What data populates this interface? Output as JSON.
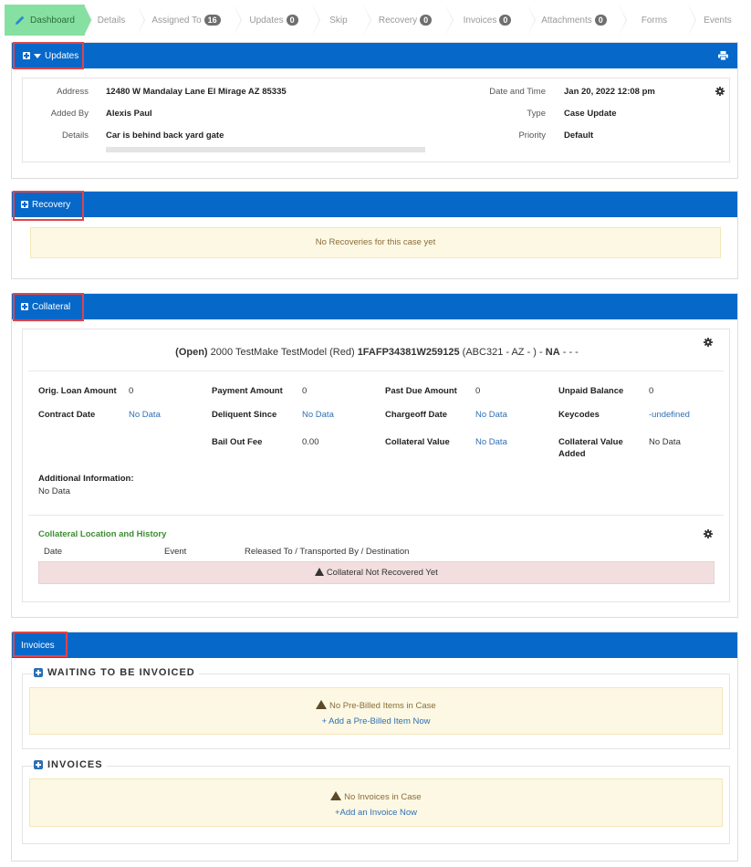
{
  "tabs": [
    {
      "label": "Dashboard",
      "active": true
    },
    {
      "label": "Details"
    },
    {
      "label": "Assigned To",
      "badge": "16"
    },
    {
      "label": "Updates",
      "badge": "0"
    },
    {
      "label": "Skip"
    },
    {
      "label": "Recovery",
      "badge": "0"
    },
    {
      "label": "Invoices",
      "badge": "0"
    },
    {
      "label": "Attachments",
      "badge": "0"
    },
    {
      "label": "Forms"
    },
    {
      "label": "Events"
    }
  ],
  "updates": {
    "title": "Updates",
    "address_label": "Address",
    "address": "12480 W Mandalay Lane El Mirage AZ 85335",
    "added_by_label": "Added By",
    "added_by": "Alexis Paul",
    "details_label": "Details",
    "details": "Car is behind back yard gate",
    "datetime_label": "Date and Time",
    "datetime": "Jan 20, 2022 12:08 pm",
    "type_label": "Type",
    "type": "Case Update",
    "priority_label": "Priority",
    "priority": "Default"
  },
  "recovery": {
    "title": "Recovery",
    "empty": "No Recoveries for this case yet"
  },
  "collateral": {
    "title": "Collateral",
    "summary_status": "(Open)",
    "summary_vehicle": "2000 TestMake TestModel (Red)",
    "summary_vin": "1FAFP34381W259125",
    "summary_plate": "(ABC321 - AZ - ) -",
    "summary_na": "NA",
    "summary_tail": "- - -",
    "fields": {
      "orig_loan_label": "Orig. Loan Amount",
      "orig_loan": "0",
      "payment_label": "Payment Amount",
      "payment": "0",
      "past_due_label": "Past Due Amount",
      "past_due": "0",
      "unpaid_label": "Unpaid Balance",
      "unpaid": "0",
      "contract_label": "Contract Date",
      "contract": "No Data",
      "delinquent_label": "Deliquent Since",
      "delinquent": "No Data",
      "chargeoff_label": "Chargeoff Date",
      "chargeoff": "No Data",
      "keycodes_label": "Keycodes",
      "keycodes": "-undefined",
      "bailout_label": "Bail Out Fee",
      "bailout": "0.00",
      "coll_value_label": "Collateral Value",
      "coll_value": "No Data",
      "coll_added_label_1": "Collateral Value",
      "coll_added_label_2": "Added",
      "coll_added": "No Data"
    },
    "additional_label": "Additional Information:",
    "additional": "No Data",
    "history_title": "Collateral Location and History",
    "history_cols": [
      "Date",
      "Event",
      "Released To / Transported By / Destination"
    ],
    "history_empty": "Collateral Not Recovered Yet"
  },
  "invoices": {
    "title": "Invoices",
    "waiting_title": "WAITING TO BE INVOICED",
    "waiting_empty": "No Pre-Billed Items in Case",
    "waiting_add": "+ Add a Pre-Billed Item Now",
    "invoices_title": "INVOICES",
    "invoices_empty": "No Invoices in Case",
    "invoices_add": "+Add an Invoice Now"
  },
  "colors": {
    "header_blue": "#0668c9",
    "active_tab": "#86e0a2",
    "highlight_red": "#e0434b",
    "notice_bg": "#fcf8e3",
    "error_bg": "#f2dede"
  }
}
